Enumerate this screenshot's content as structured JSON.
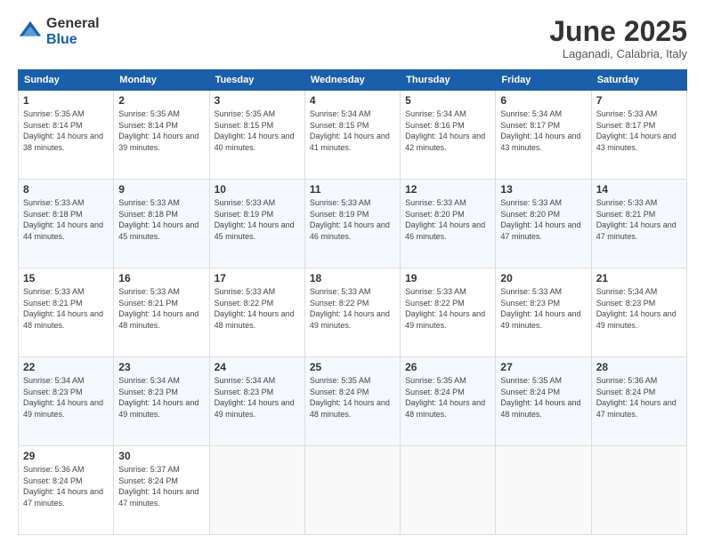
{
  "logo": {
    "general": "General",
    "blue": "Blue"
  },
  "header": {
    "title": "June 2025",
    "subtitle": "Laganadi, Calabria, Italy"
  },
  "calendar": {
    "days_of_week": [
      "Sunday",
      "Monday",
      "Tuesday",
      "Wednesday",
      "Thursday",
      "Friday",
      "Saturday"
    ],
    "weeks": [
      [
        {
          "day": null
        },
        {
          "day": 2,
          "sunrise": "5:35 AM",
          "sunset": "8:14 PM",
          "daylight": "14 hours and 39 minutes."
        },
        {
          "day": 3,
          "sunrise": "5:35 AM",
          "sunset": "8:15 PM",
          "daylight": "14 hours and 40 minutes."
        },
        {
          "day": 4,
          "sunrise": "5:34 AM",
          "sunset": "8:15 PM",
          "daylight": "14 hours and 41 minutes."
        },
        {
          "day": 5,
          "sunrise": "5:34 AM",
          "sunset": "8:16 PM",
          "daylight": "14 hours and 42 minutes."
        },
        {
          "day": 6,
          "sunrise": "5:34 AM",
          "sunset": "8:17 PM",
          "daylight": "14 hours and 43 minutes."
        },
        {
          "day": 7,
          "sunrise": "5:33 AM",
          "sunset": "8:17 PM",
          "daylight": "14 hours and 43 minutes."
        }
      ],
      [
        {
          "day": 1,
          "sunrise": "5:35 AM",
          "sunset": "8:14 PM",
          "daylight": "14 hours and 38 minutes."
        },
        {
          "day": null
        },
        {
          "day": null
        },
        {
          "day": null
        },
        {
          "day": null
        },
        {
          "day": null
        },
        {
          "day": null
        }
      ],
      [
        {
          "day": 8,
          "sunrise": "5:33 AM",
          "sunset": "8:18 PM",
          "daylight": "14 hours and 44 minutes."
        },
        {
          "day": 9,
          "sunrise": "5:33 AM",
          "sunset": "8:18 PM",
          "daylight": "14 hours and 45 minutes."
        },
        {
          "day": 10,
          "sunrise": "5:33 AM",
          "sunset": "8:19 PM",
          "daylight": "14 hours and 45 minutes."
        },
        {
          "day": 11,
          "sunrise": "5:33 AM",
          "sunset": "8:19 PM",
          "daylight": "14 hours and 46 minutes."
        },
        {
          "day": 12,
          "sunrise": "5:33 AM",
          "sunset": "8:20 PM",
          "daylight": "14 hours and 46 minutes."
        },
        {
          "day": 13,
          "sunrise": "5:33 AM",
          "sunset": "8:20 PM",
          "daylight": "14 hours and 47 minutes."
        },
        {
          "day": 14,
          "sunrise": "5:33 AM",
          "sunset": "8:21 PM",
          "daylight": "14 hours and 47 minutes."
        }
      ],
      [
        {
          "day": 15,
          "sunrise": "5:33 AM",
          "sunset": "8:21 PM",
          "daylight": "14 hours and 48 minutes."
        },
        {
          "day": 16,
          "sunrise": "5:33 AM",
          "sunset": "8:21 PM",
          "daylight": "14 hours and 48 minutes."
        },
        {
          "day": 17,
          "sunrise": "5:33 AM",
          "sunset": "8:22 PM",
          "daylight": "14 hours and 48 minutes."
        },
        {
          "day": 18,
          "sunrise": "5:33 AM",
          "sunset": "8:22 PM",
          "daylight": "14 hours and 49 minutes."
        },
        {
          "day": 19,
          "sunrise": "5:33 AM",
          "sunset": "8:22 PM",
          "daylight": "14 hours and 49 minutes."
        },
        {
          "day": 20,
          "sunrise": "5:33 AM",
          "sunset": "8:23 PM",
          "daylight": "14 hours and 49 minutes."
        },
        {
          "day": 21,
          "sunrise": "5:34 AM",
          "sunset": "8:23 PM",
          "daylight": "14 hours and 49 minutes."
        }
      ],
      [
        {
          "day": 22,
          "sunrise": "5:34 AM",
          "sunset": "8:23 PM",
          "daylight": "14 hours and 49 minutes."
        },
        {
          "day": 23,
          "sunrise": "5:34 AM",
          "sunset": "8:23 PM",
          "daylight": "14 hours and 49 minutes."
        },
        {
          "day": 24,
          "sunrise": "5:34 AM",
          "sunset": "8:23 PM",
          "daylight": "14 hours and 49 minutes."
        },
        {
          "day": 25,
          "sunrise": "5:35 AM",
          "sunset": "8:24 PM",
          "daylight": "14 hours and 48 minutes."
        },
        {
          "day": 26,
          "sunrise": "5:35 AM",
          "sunset": "8:24 PM",
          "daylight": "14 hours and 48 minutes."
        },
        {
          "day": 27,
          "sunrise": "5:35 AM",
          "sunset": "8:24 PM",
          "daylight": "14 hours and 48 minutes."
        },
        {
          "day": 28,
          "sunrise": "5:36 AM",
          "sunset": "8:24 PM",
          "daylight": "14 hours and 47 minutes."
        }
      ],
      [
        {
          "day": 29,
          "sunrise": "5:36 AM",
          "sunset": "8:24 PM",
          "daylight": "14 hours and 47 minutes."
        },
        {
          "day": 30,
          "sunrise": "5:37 AM",
          "sunset": "8:24 PM",
          "daylight": "14 hours and 47 minutes."
        },
        {
          "day": null
        },
        {
          "day": null
        },
        {
          "day": null
        },
        {
          "day": null
        },
        {
          "day": null
        }
      ]
    ]
  }
}
